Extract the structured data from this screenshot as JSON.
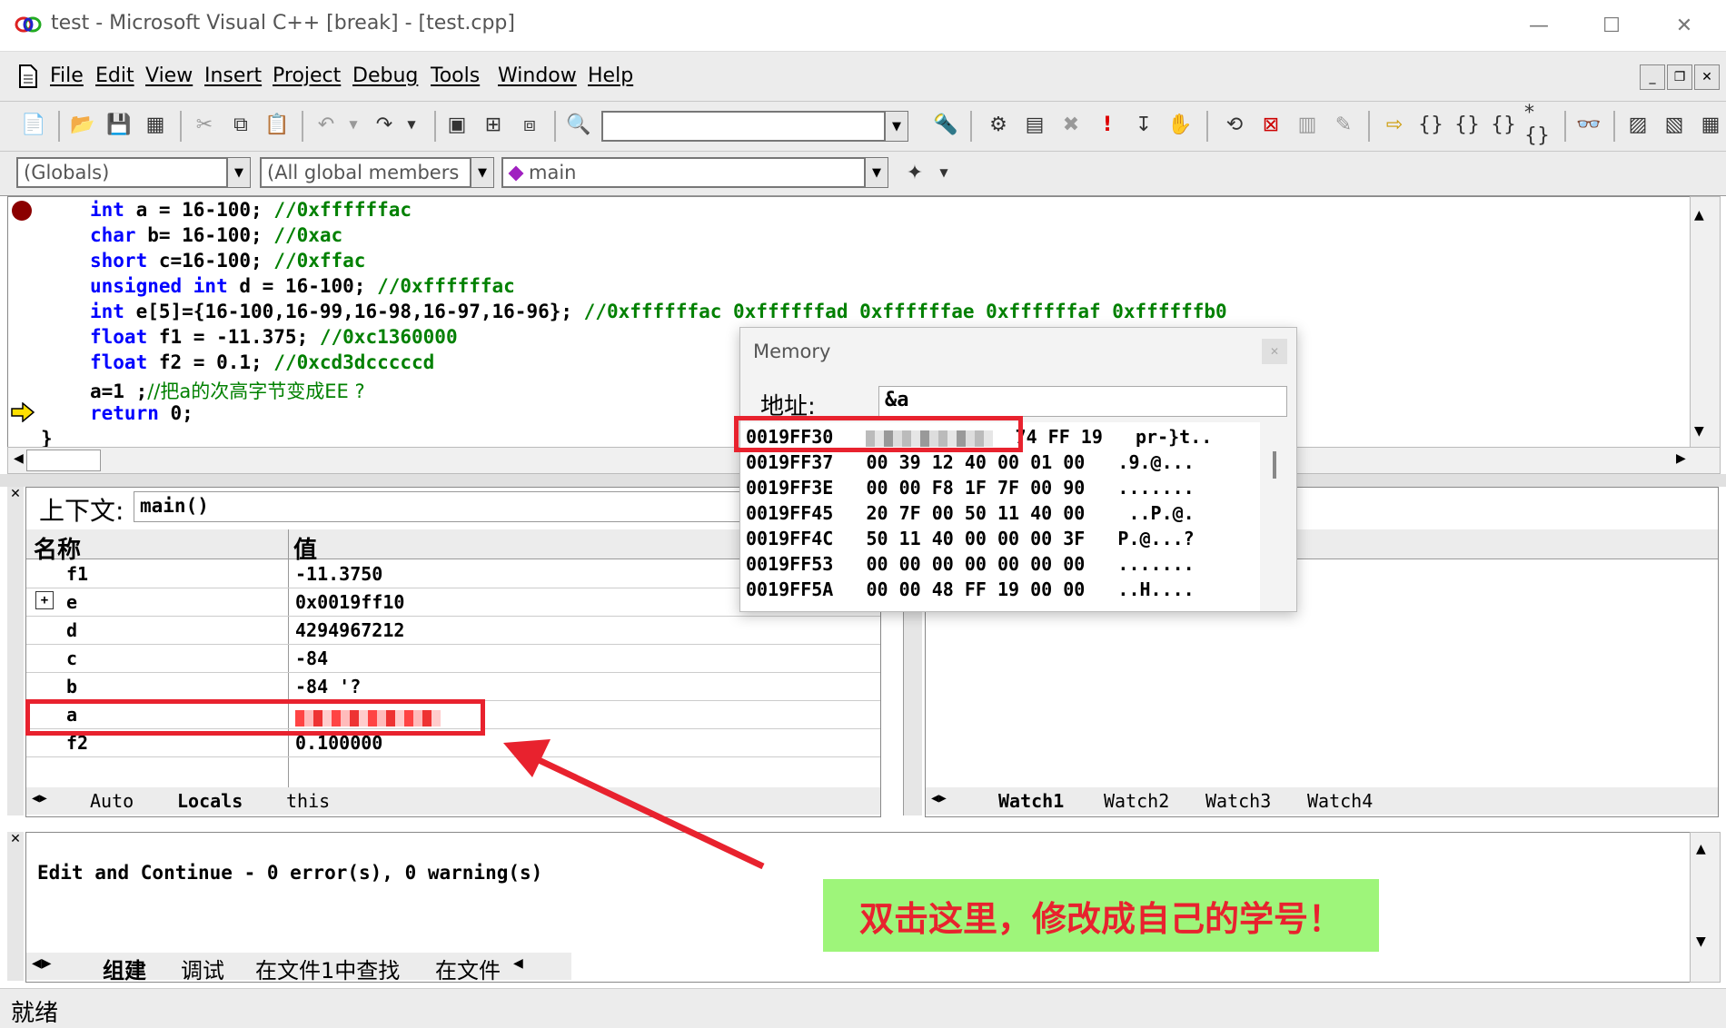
{
  "window": {
    "title": "test - Microsoft Visual C++ [break] - [test.cpp]",
    "minimize": "—",
    "maximize": "☐",
    "close": "✕"
  },
  "menu": [
    "File",
    "Edit",
    "View",
    "Insert",
    "Project",
    "Debug",
    "Tools",
    "Window",
    "Help"
  ],
  "toolbar2": {
    "globals": "(Globals)",
    "members": "(All global members",
    "function": "main"
  },
  "code": [
    {
      "kw": "int",
      "rest": " a = 16-100; ",
      "cm": "//0xffffffac"
    },
    {
      "kw": "char",
      "rest": " b= 16-100; ",
      "cm": "//0xac"
    },
    {
      "kw": "short",
      "rest": " c=16-100; ",
      "cm": "//0xffac"
    },
    {
      "kw": "unsigned int",
      "rest": " d = 16-100; ",
      "cm": "//0xffffffac"
    },
    {
      "kw": "int",
      "rest": " e[5]={16-100,16-99,16-98,16-97,16-96}; ",
      "cm": "//0xffffffac 0xffffffad 0xffffffae 0xffffffaf 0xffffffb0"
    },
    {
      "kw": "float",
      "rest": " f1 = -11.375; ",
      "cm": "//0xc1360000"
    },
    {
      "kw": "float",
      "rest": " f2 = 0.1; ",
      "cm": "//0xcd3dcccccd"
    },
    {
      "kw": "",
      "rest": "a=1 ;",
      "cm": "//把a的次高字节变成EE ?"
    },
    {
      "kw": "return",
      "rest": " 0;",
      "cm": ""
    }
  ],
  "closing_brace": "}",
  "locals": {
    "context_label": "上下文:",
    "context_value": "main()",
    "col_name": "名称",
    "col_value": "值",
    "rows": [
      {
        "name": "f1",
        "value": "-11.3750"
      },
      {
        "name": "e",
        "value": "0x0019ff10",
        "expand": "+"
      },
      {
        "name": "d",
        "value": "4294967212"
      },
      {
        "name": "c",
        "value": "-84"
      },
      {
        "name": "b",
        "value": "-84 '?"
      },
      {
        "name": "a",
        "value": ""
      },
      {
        "name": "f2",
        "value": "0.100000"
      }
    ],
    "tabs": [
      "Auto",
      "Locals",
      "this"
    ]
  },
  "watch": {
    "tabs": [
      "Watch1",
      "Watch2",
      "Watch3",
      "Watch4"
    ]
  },
  "output": {
    "text": "Edit and Continue - 0 error(s), 0 warning(s)",
    "tabs": [
      "组建",
      "调试",
      "在文件1中查找",
      "在文件"
    ]
  },
  "status": "就绪",
  "memory": {
    "title": "Memory",
    "address_label": "地址:",
    "address_value": "&a",
    "rows": [
      {
        "addr": "0019FF30",
        "bytes": "74 FF 19",
        "ascii": "pr-}t..",
        "blurred": true
      },
      {
        "addr": "0019FF37",
        "bytes": "00 39 12 40 00 01 00",
        "ascii": ".9.@..."
      },
      {
        "addr": "0019FF3E",
        "bytes": "00 00 F8 1F 7F 00 90",
        "ascii": "......."
      },
      {
        "addr": "0019FF45",
        "bytes": "20 7F 00 50 11 40 00",
        "ascii": " ..P.@."
      },
      {
        "addr": "0019FF4C",
        "bytes": "50 11 40 00 00 00 3F",
        "ascii": "P.@...?"
      },
      {
        "addr": "0019FF53",
        "bytes": "00 00 00 00 00 00 00",
        "ascii": "......."
      },
      {
        "addr": "0019FF5A",
        "bytes": "00 00 48 FF 19 00 00",
        "ascii": "..H...."
      }
    ]
  },
  "callout": "双击这里，修改成自己的学号！",
  "colors": {
    "accent_red": "#e8222e",
    "callout_bg": "#9ef57a",
    "keyword": "#0000ff",
    "comment": "#008000"
  }
}
